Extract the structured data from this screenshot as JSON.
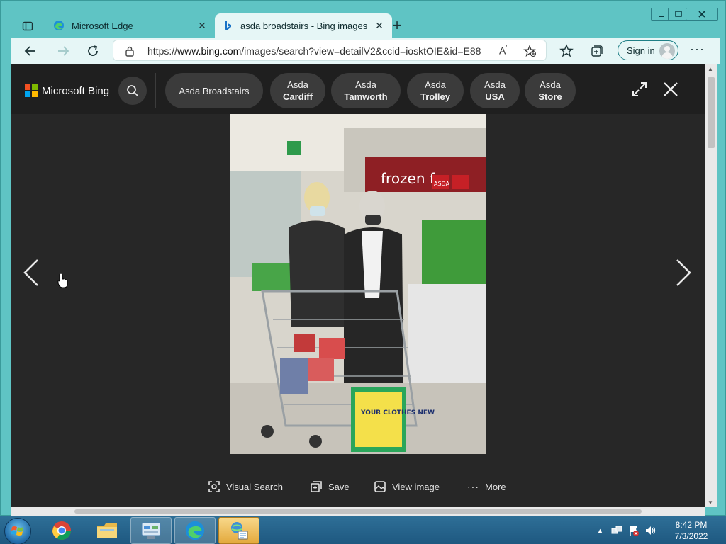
{
  "browser": {
    "tabs": [
      {
        "title": "Microsoft Edge"
      },
      {
        "title": "asda broadstairs - Bing images"
      }
    ],
    "address": {
      "prefix": "https://",
      "host": "www.bing.com",
      "path": "/images/search?view=detailV2&ccid=iosktOIE&id=E88..."
    },
    "sign_in_label": "Sign in"
  },
  "bing": {
    "brand": "Microsoft Bing",
    "chips": [
      {
        "line1": "Asda Broadstairs",
        "line2": ""
      },
      {
        "line1": "Asda",
        "line2": "Cardiff"
      },
      {
        "line1": "Asda",
        "line2": "Tamworth"
      },
      {
        "line1": "Asda",
        "line2": "Trolley"
      },
      {
        "line1": "Asda",
        "line2": "USA"
      },
      {
        "line1": "Asda",
        "line2": "Store"
      }
    ],
    "actions": {
      "visual_search": "Visual Search",
      "save": "Save",
      "view_image": "View image",
      "more": "More"
    },
    "photo_text": {
      "frozen": "frozen fo",
      "asda": "ASDA",
      "sign": "YOUR CLOTHES NEW"
    }
  },
  "taskbar": {
    "time": "8:42 PM",
    "date": "7/3/2022"
  },
  "colors": {
    "frame": "#5fc4c4",
    "bing_bg": "#272727",
    "bing_header": "#1f1f1f",
    "chip": "#3b3b3b"
  }
}
